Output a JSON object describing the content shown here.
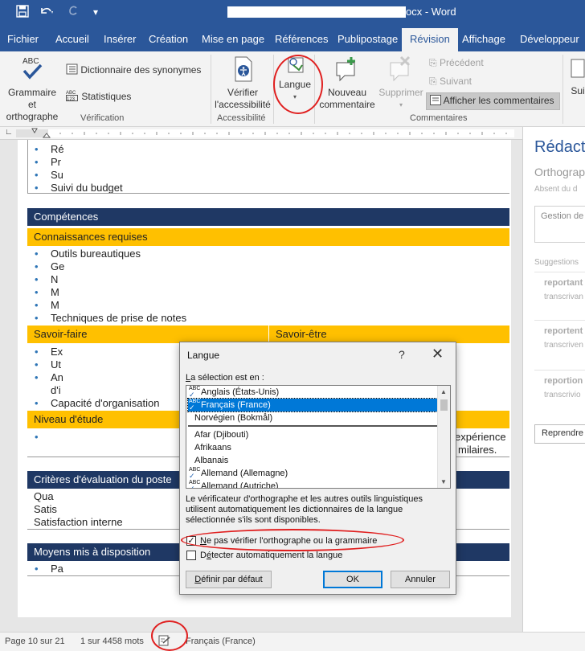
{
  "titlebar": {
    "title": "ocx  -  Word",
    "quick_access": {
      "save_icon": "save-icon",
      "undo_icon": "undo-icon",
      "redo_icon": "redo-icon",
      "customize_icon": "customize-icon"
    }
  },
  "tabs": [
    "Fichier",
    "Accueil",
    "Insérer",
    "Création",
    "Mise en page",
    "Références",
    "Publipostage",
    "Révision",
    "Affichage",
    "Développeur"
  ],
  "active_tab": "Révision",
  "ribbon": {
    "verification": {
      "group_label": "Vérification",
      "spelling_button": "Grammaire et orthographe",
      "synonyms_button": "Dictionnaire des synonymes",
      "stats_button": "Statistiques"
    },
    "accessibility": {
      "group_label": "Accessibilité",
      "check_button": "Vérifier l'accessibilité"
    },
    "language": {
      "button": "Langue"
    },
    "comments": {
      "group_label": "Commentaires",
      "new_comment": "Nouveau commentaire",
      "delete": "Supprimer",
      "previous": "Précédent",
      "next": "Suivant",
      "show_comments": "Afficher les commentaires"
    },
    "partial_right": "Sui"
  },
  "document": {
    "top_bullets": [
      "Ré",
      "Pr",
      "Su",
      "Suivi du budget"
    ],
    "competences": {
      "header": "Compétences",
      "known_header": "Connaissances requises",
      "known_bullets": [
        "Outils bureautiques",
        "Ge",
        "N",
        "M",
        "M",
        "Techniques de prise de notes"
      ],
      "savoir_faire": "Savoir-faire",
      "savoir_etre": "Savoir-être",
      "sf_bullets": [
        "Ex",
        "Ut",
        "An",
        "Capacité d'organisation"
      ],
      "sf_extra": "d'i",
      "se_right_a": "expérience",
      "se_right_b": "milaires.",
      "niveau": "Niveau d'étude"
    },
    "criteres": {
      "header": "Critères d'évaluation du poste",
      "lines": [
        "Qua",
        "Satis",
        "Satisfaction interne"
      ]
    },
    "moyens": {
      "header": "Moyens mis à disposition",
      "bullets": [
        "Pa"
      ]
    }
  },
  "pane": {
    "title": "Rédact",
    "subtitle": "Orthograp",
    "absent": "Absent du d",
    "field": "Gestion de",
    "suggestions_label": "Suggestions",
    "suggestions": [
      {
        "word": "reportant",
        "sub": "transcrivan"
      },
      {
        "word": "reportent",
        "sub": "transcriven"
      },
      {
        "word": "reportion",
        "sub": "transcrivio"
      }
    ],
    "resume_button": "Reprendre"
  },
  "status": {
    "page": "Page 10 sur 21",
    "words": "1 sur 4458 mots",
    "proofing_icon": "proofing-icon",
    "language": "Français (France)"
  },
  "dialog": {
    "title": "Langue",
    "help": "?",
    "close": "✕",
    "selection_label": "La sélection est en :",
    "languages": [
      {
        "name": "Anglais (États-Unis)",
        "abc": true,
        "selected": false,
        "separator_after": false
      },
      {
        "name": "Français (France)",
        "abc": true,
        "selected": true,
        "separator_after": false
      },
      {
        "name": "Norvégien (Bokmål)",
        "abc": false,
        "selected": false,
        "separator_after": true
      },
      {
        "name": "Afar (Djibouti)",
        "abc": false,
        "selected": false,
        "separator_after": false
      },
      {
        "name": "Afrikaans",
        "abc": false,
        "selected": false,
        "separator_after": false
      },
      {
        "name": "Albanais",
        "abc": false,
        "selected": false,
        "separator_after": false
      },
      {
        "name": "Allemand (Allemagne)",
        "abc": true,
        "selected": false,
        "separator_after": false
      },
      {
        "name": "Allemand (Autriche)",
        "abc": true,
        "selected": false,
        "separator_after": false
      }
    ],
    "info": "Le vérificateur d'orthographe et les autres outils linguistiques utilisent automatiquement les dictionnaires de la langue sélectionnée s'ils sont disponibles.",
    "no_check_label": "Ne pas vérifier l'orthographe ou la grammaire",
    "no_check_checked": true,
    "detect_label": "Détecter automatiquement la langue",
    "detect_checked": false,
    "default_button": "Définir par défaut",
    "ok_button": "OK",
    "cancel_button": "Annuler"
  }
}
